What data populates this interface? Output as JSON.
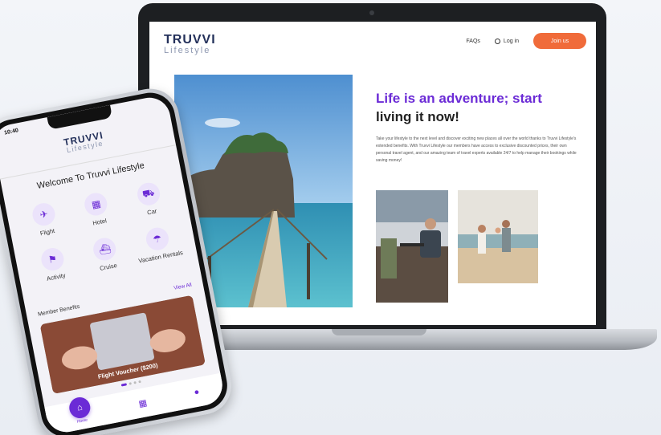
{
  "website": {
    "logo": {
      "brand": "TRUVVI",
      "sub": "Lifestyle"
    },
    "nav": {
      "faqs": "FAQs",
      "login": "Log in",
      "join": "Join us"
    },
    "hero": {
      "title_accent": "Life is an adventure; start",
      "title_rest": "living it now!",
      "body": "Take your lifestyle to the next level and discover exciting new places all over the world thanks to Truvvi Lifestyle's extended benefits. With Truvvi Lifestyle our members have access to exclusive discounted prices, their own personal travel agent, and our amazing team of travel experts available 24/7 to help manage their bookings while saving money!"
    }
  },
  "app": {
    "status_time": "10:40",
    "logo": {
      "brand": "TRUVVI",
      "sub": "Lifestyle"
    },
    "welcome": "Welcome To Truvvi Lifestyle",
    "services": [
      {
        "label": "Flight",
        "icon": "plane-icon",
        "glyph": "✈"
      },
      {
        "label": "Hotel",
        "icon": "hotel-icon",
        "glyph": "▦"
      },
      {
        "label": "Car",
        "icon": "car-icon",
        "glyph": "⛟"
      },
      {
        "label": "Activity",
        "icon": "activity-icon",
        "glyph": "⚑"
      },
      {
        "label": "Cruise",
        "icon": "cruise-icon",
        "glyph": "⛴"
      },
      {
        "label": "Vacation Rentals",
        "icon": "beach-umbrella-icon",
        "glyph": "☂"
      }
    ],
    "benefits_title": "Member Benefits",
    "view_all": "View All",
    "benefit_caption": "Flight Voucher ($200)",
    "tabs": {
      "home": "Home"
    }
  },
  "colors": {
    "accent": "#6b2bd6",
    "cta": "#f06b3a",
    "brand_navy": "#23305a"
  }
}
